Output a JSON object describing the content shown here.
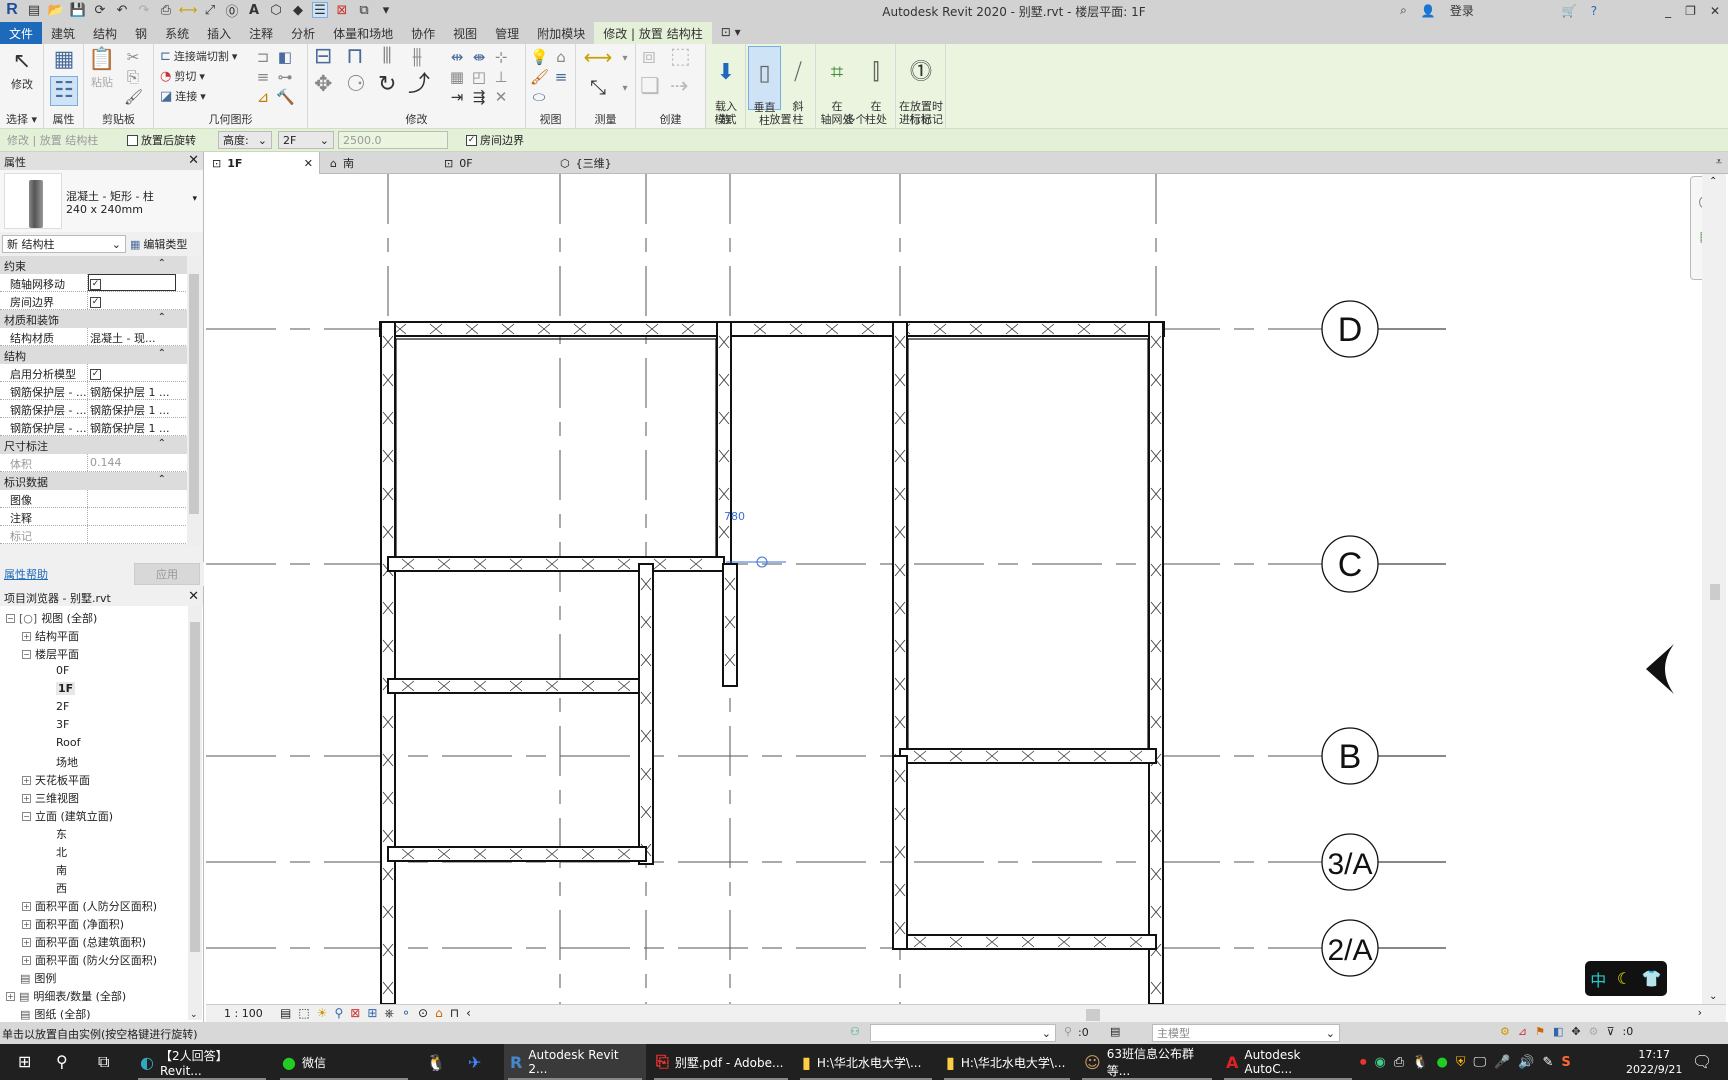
{
  "app": {
    "title": "Autodesk Revit 2020 - 别墅.rvt - 楼层平面: 1F",
    "login_label": "登录"
  },
  "ribbon_tabs": [
    "文件",
    "建筑",
    "结构",
    "钢",
    "系统",
    "插入",
    "注释",
    "分析",
    "体量和场地",
    "协作",
    "视图",
    "管理",
    "附加模块",
    "修改 | 放置 结构柱"
  ],
  "ribbon": {
    "select": {
      "modify": "修改",
      "label": "选择 ▾"
    },
    "properties": {
      "label": "属性"
    },
    "clipboard": {
      "paste": "粘贴",
      "label": "剪贴板"
    },
    "geometry": {
      "cut_join": "连接端切割",
      "cut": "剪切",
      "join": "连接",
      "label": "几何图形"
    },
    "modify": {
      "label": "修改"
    },
    "view": {
      "label": "视图"
    },
    "measure": {
      "label": "测量"
    },
    "create": {
      "label": "创建"
    },
    "mode": {
      "load_family": "载入\n族",
      "label": "模式"
    },
    "placement": {
      "vertical": "垂直\n柱",
      "slanted": "斜\n柱",
      "label": "放置"
    },
    "multiple": {
      "at_grids": "在\n轴网处",
      "at_columns": "在\n柱处",
      "label": "多个"
    },
    "tag": {
      "tag_on_place": "在放置时\n进行标记",
      "label": "标记"
    }
  },
  "options_bar": {
    "context": "修改 | 放置 结构柱",
    "rotate_after": "放置后旋转",
    "rotate_after_checked": false,
    "height_mode": "高度:",
    "level": "2F",
    "offset": "2500.0",
    "room_bounding": "房间边界",
    "room_bounding_checked": true
  },
  "properties": {
    "header": "属性",
    "type_name_line1": "混凝土 - 矩形 - 柱",
    "type_name_line2": "240 x 240mm",
    "instance_selector": "新 结构柱",
    "edit_type": "编辑类型",
    "categories": [
      {
        "name": "约束",
        "rows": [
          {
            "key": "随轴网移动",
            "value": "",
            "checked": true
          },
          {
            "key": "房间边界",
            "value": "",
            "checked": true
          }
        ]
      },
      {
        "name": "材质和装饰",
        "rows": [
          {
            "key": "结构材质",
            "value": "混凝土 - 现..."
          }
        ]
      },
      {
        "name": "结构",
        "rows": [
          {
            "key": "启用分析模型",
            "value": "",
            "checked": true
          },
          {
            "key": "钢筋保护层 - ...",
            "value": "钢筋保护层 1 ..."
          },
          {
            "key": "钢筋保护层 - ...",
            "value": "钢筋保护层 1 ..."
          },
          {
            "key": "钢筋保护层 - ...",
            "value": "钢筋保护层 1 ..."
          }
        ]
      },
      {
        "name": "尺寸标注",
        "rows": [
          {
            "key": "体积",
            "value": "0.144",
            "muted": true
          }
        ]
      },
      {
        "name": "标识数据",
        "rows": [
          {
            "key": "图像",
            "value": ""
          },
          {
            "key": "注释",
            "value": ""
          },
          {
            "key": "标记",
            "value": "",
            "muted": true
          }
        ]
      }
    ],
    "help_link": "属性帮助",
    "apply": "应用"
  },
  "project_browser": {
    "header": "项目浏览器 - 别墅.rvt",
    "items": [
      {
        "label": "视图 (全部)",
        "level": 0,
        "toggle": "−"
      },
      {
        "label": "结构平面",
        "level": 1,
        "toggle": "+"
      },
      {
        "label": "楼层平面",
        "level": 1,
        "toggle": "−"
      },
      {
        "label": "0F",
        "level": 2
      },
      {
        "label": "1F",
        "level": 2,
        "bold": true
      },
      {
        "label": "2F",
        "level": 2
      },
      {
        "label": "3F",
        "level": 2
      },
      {
        "label": "Roof",
        "level": 2
      },
      {
        "label": "场地",
        "level": 2
      },
      {
        "label": "天花板平面",
        "level": 1,
        "toggle": "+"
      },
      {
        "label": "三维视图",
        "level": 1,
        "toggle": "+"
      },
      {
        "label": "立面 (建筑立面)",
        "level": 1,
        "toggle": "−"
      },
      {
        "label": "东",
        "level": 2
      },
      {
        "label": "北",
        "level": 2
      },
      {
        "label": "南",
        "level": 2
      },
      {
        "label": "西",
        "level": 2
      },
      {
        "label": "面积平面 (人防分区面积)",
        "level": 1,
        "toggle": "+"
      },
      {
        "label": "面积平面 (净面积)",
        "level": 1,
        "toggle": "+"
      },
      {
        "label": "面积平面 (总建筑面积)",
        "level": 1,
        "toggle": "+"
      },
      {
        "label": "面积平面 (防火分区面积)",
        "level": 1,
        "toggle": "+"
      },
      {
        "label": "图例",
        "level": 0.5
      },
      {
        "label": "明细表/数量 (全部)",
        "level": 0,
        "toggle": "+"
      },
      {
        "label": "图纸 (全部)",
        "level": 0.5
      }
    ]
  },
  "view_tabs": [
    {
      "label": "1F",
      "active": true
    },
    {
      "label": "南"
    },
    {
      "label": "0F"
    },
    {
      "label": "{三维}"
    }
  ],
  "drawing": {
    "grid_bubbles": [
      "D",
      "C",
      "B",
      "3/A",
      "2/A"
    ],
    "dimension_temp": "780"
  },
  "view_control": {
    "scale": "1 : 100"
  },
  "status": {
    "message": "单击以放置自由实例(按空格键进行旋转)",
    "selection_count": ":0",
    "workset": "主模型",
    "filter_count": ":0"
  },
  "ime": {
    "lang": "中"
  },
  "taskbar": {
    "items": [
      {
        "label": "【2人回答】Revit...",
        "icon": "edge-icon"
      },
      {
        "label": "微信",
        "icon": "wechat-icon"
      },
      {
        "label": "",
        "icon": "qq-icon"
      },
      {
        "label": "",
        "icon": "feishu-icon"
      },
      {
        "label": "Autodesk Revit 2...",
        "icon": "revit-icon",
        "active": true
      },
      {
        "label": "别墅.pdf - Adobe...",
        "icon": "pdf-icon"
      },
      {
        "label": "H:\\华北水电大学\\...",
        "icon": "folder-icon"
      },
      {
        "label": "H:\\华北水电大学\\...",
        "icon": "folder-icon"
      },
      {
        "label": "63班信息公布群等...",
        "icon": "avatar-icon"
      },
      {
        "label": "Autodesk AutoC...",
        "icon": "autocad-icon"
      }
    ],
    "time": "17:17",
    "date": "2022/9/21"
  },
  "colors": {
    "file_tab": "#1c6ab9",
    "context_tab": "#e4f1d8",
    "selection": "#cfe3f7",
    "temp_dim": "#3a6fd8"
  }
}
